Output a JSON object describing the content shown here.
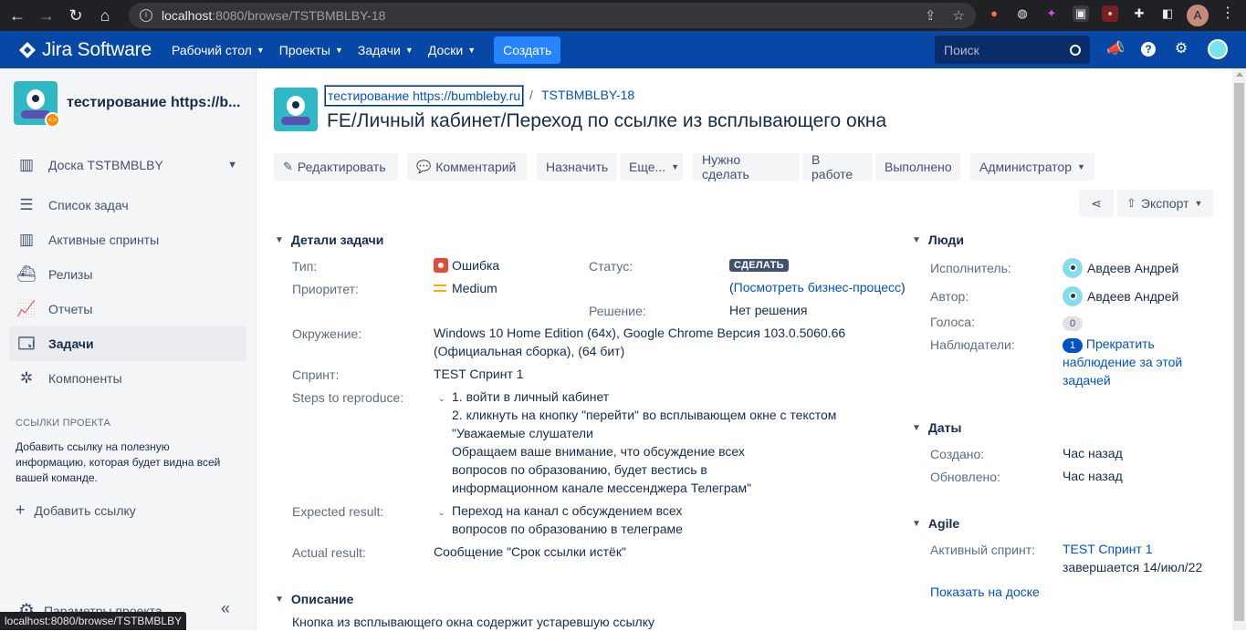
{
  "browser": {
    "url_host": "localhost",
    "url_rest": ":8080/browse/TSTBMBLBY-18",
    "profile_initial": "A",
    "status_url": "localhost:8080/browse/TSTBMBLBY"
  },
  "topnav": {
    "logo": "Jira Software",
    "menu": [
      "Рабочий стол",
      "Проекты",
      "Задачи",
      "Доски"
    ],
    "create": "Создать",
    "search_placeholder": "Поиск"
  },
  "sidebar": {
    "project_name": "тестирование https://b...",
    "items": [
      {
        "label": "Доска TSTBMBLBY"
      },
      {
        "label": "Список задач"
      },
      {
        "label": "Активные спринты"
      },
      {
        "label": "Релизы"
      },
      {
        "label": "Отчеты"
      },
      {
        "label": "Задачи"
      },
      {
        "label": "Компоненты"
      }
    ],
    "links_title": "ССЫЛКИ ПРОЕКТА",
    "links_desc": "Добавить ссылку на полезную информацию, которая будет видна всей вашей команде.",
    "add_link": "Добавить ссылку",
    "settings": "Параметры проекта"
  },
  "issue": {
    "breadcrumb_project": "тестирование https://bumbleby.ru",
    "breadcrumb_sep": "/",
    "breadcrumb_key": "TSTBMBLBY-18",
    "title": "FE/Личный кабинет/Переход по ссылке из всплывающего окна",
    "actions": {
      "edit": "Редактировать",
      "comment": "Комментарий",
      "assign": "Назначить",
      "more": "Еще...",
      "todo": "Нужно сделать",
      "inprogress": "В работе",
      "done": "Выполнено",
      "admin": "Администратор",
      "export": "Экспорт"
    },
    "details": {
      "heading": "Детали задачи",
      "type_label": "Тип:",
      "type_value": "Ошибка",
      "priority_label": "Приоритет:",
      "priority_value": "Medium",
      "status_label": "Статус:",
      "status_value": "СДЕЛАТЬ",
      "workflow_open": "(",
      "workflow_link": "Посмотреть бизнес-процесс",
      "workflow_close": ")",
      "resolution_label": "Решение:",
      "resolution_value": "Нет решения",
      "env_label": "Окружение:",
      "env_line1": "Windows 10 Home Edition (64x), Google Chrome Версия 103.0.5060.66",
      "env_line2": "(Официальная сборка), (64 бит)",
      "sprint_label": "Спринт:",
      "sprint_value": "TEST Спринт 1",
      "steps_label": "Steps to reproduce:",
      "steps_lines": [
        "1. войти в личный кабинет",
        "2. кликнуть на кнопку \"перейти\" во всплывающем окне с текстом",
        "\"Уважаемые слушатели",
        "Обращаем ваше внимание, что обсуждение всех",
        "вопросов по образованию, будет вестись в",
        "информационном канале мессенджера Телеграм\""
      ],
      "expected_label": "Expected result:",
      "expected_lines": [
        "Переход на канал с обсуждением всех",
        "вопросов по образованию в телеграме"
      ],
      "actual_label": "Actual result:",
      "actual_value": "Сообщение \"Срок ссылки истёк\""
    },
    "description": {
      "heading": "Описание",
      "text": "Кнопка из всплывающего окна содержит устаревшую ссылку"
    },
    "people": {
      "heading": "Люди",
      "assignee_label": "Исполнитель:",
      "assignee": "Авдеев Андрей",
      "reporter_label": "Автор:",
      "reporter": "Авдеев Андрей",
      "votes_label": "Голоса:",
      "votes": "0",
      "watchers_label": "Наблюдатели:",
      "watchers": "1",
      "watch_link_lines": [
        "Прекратить",
        "наблюдение за этой",
        "задачей"
      ]
    },
    "dates": {
      "heading": "Даты",
      "created_label": "Создано:",
      "created": "Час назад",
      "updated_label": "Обновлено:",
      "updated": "Час назад"
    },
    "agile": {
      "heading": "Agile",
      "sprint_label": "Активный спринт:",
      "sprint": "TEST Спринт 1",
      "ends": "завершается 14/июл/22",
      "board_link": "Показать на доске"
    }
  },
  "colors": {
    "nav_bg": "#0747a6",
    "create_bg": "#2684ff",
    "link": "#0052cc",
    "status_lozenge": "#42526e",
    "bug": "#e5493a",
    "priority_medium": "#ffab00"
  }
}
